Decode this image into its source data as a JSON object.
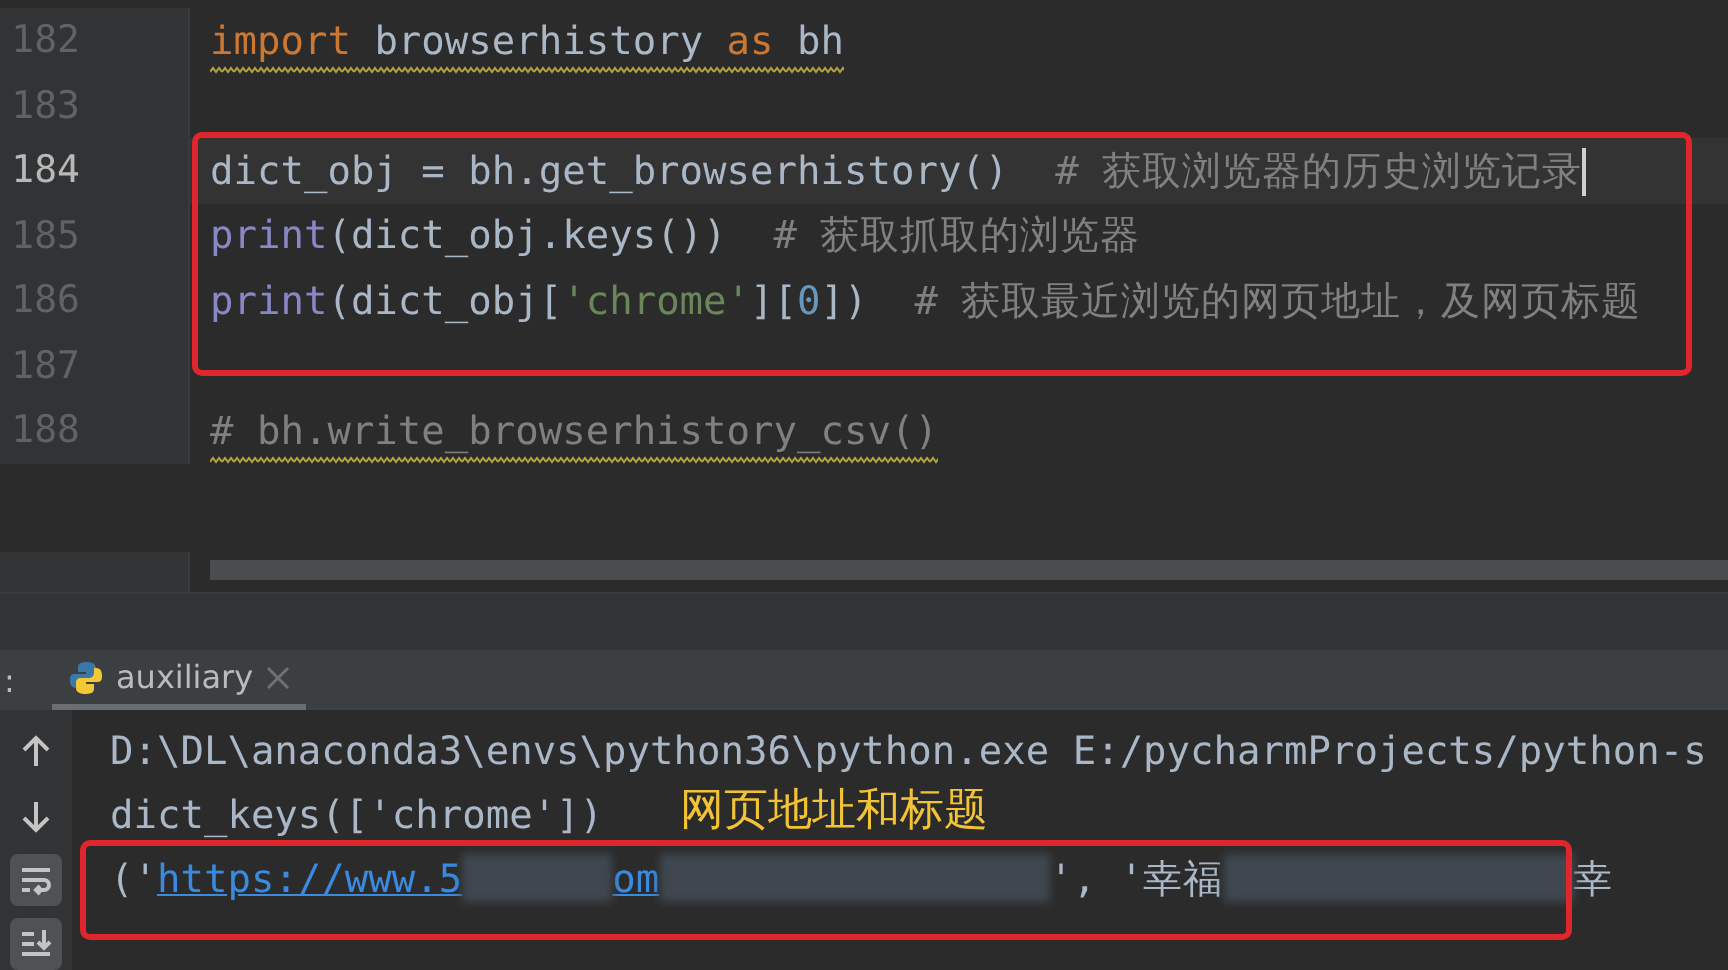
{
  "editor": {
    "lines": [
      {
        "number": "182",
        "current": false,
        "warning": true,
        "tokens": [
          {
            "kind": "keyword",
            "text": "import"
          },
          {
            "kind": "plain",
            "text": " browserhistory "
          },
          {
            "kind": "keyword",
            "text": "as"
          },
          {
            "kind": "plain",
            "text": " bh"
          }
        ]
      },
      {
        "number": "183",
        "current": false
      },
      {
        "number": "184",
        "current": true,
        "warning": false,
        "tokens": [
          {
            "kind": "plain",
            "text": "dict_obj = bh.get_browserhistory()  "
          },
          {
            "kind": "comment",
            "text": "# 获取浏览器的历史浏览记录"
          }
        ]
      },
      {
        "number": "185",
        "current": false,
        "warning": false,
        "tokens": [
          {
            "kind": "builtin",
            "text": "print"
          },
          {
            "kind": "plain",
            "text": "(dict_obj.keys())  "
          },
          {
            "kind": "comment",
            "text": "# 获取抓取的浏览器"
          }
        ]
      },
      {
        "number": "186",
        "current": false,
        "warning": false,
        "tokens": [
          {
            "kind": "builtin",
            "text": "print"
          },
          {
            "kind": "plain",
            "text": "(dict_obj["
          },
          {
            "kind": "string",
            "text": "'chrome'"
          },
          {
            "kind": "plain",
            "text": "]["
          },
          {
            "kind": "number",
            "text": "0"
          },
          {
            "kind": "plain",
            "text": "])  "
          },
          {
            "kind": "comment",
            "text": "# 获取最近浏览的网页地址，及网页标题"
          }
        ]
      },
      {
        "number": "187",
        "current": false
      },
      {
        "number": "188",
        "current": false,
        "warning": true,
        "tokens": [
          {
            "kind": "comment",
            "text": "# bh.write_browserhistory_csv()"
          }
        ]
      }
    ]
  },
  "run_panel": {
    "label": ":",
    "tabs": [
      {
        "label": "auxiliary",
        "selected": true
      }
    ],
    "toolbar": [
      {
        "kind": "up",
        "on": false
      },
      {
        "kind": "down",
        "on": false
      },
      {
        "kind": "wrap",
        "on": true
      },
      {
        "kind": "scroll-end",
        "on": true
      }
    ],
    "output": [
      [
        {
          "kind": "plain",
          "text": "D:\\DL\\anaconda3\\envs\\python36\\python.exe E:/pycharmProjects/python-s"
        }
      ],
      [
        {
          "kind": "plain",
          "text": "dict_keys(['chrome'])"
        }
      ],
      [
        {
          "kind": "plain",
          "text": "('"
        },
        {
          "kind": "link",
          "text": "https://www.5"
        },
        {
          "kind": "redacted"
        },
        {
          "kind": "link",
          "text": "om"
        },
        {
          "kind": "redacted"
        },
        {
          "kind": "plain",
          "text": "', '幸福"
        },
        {
          "kind": "redacted"
        },
        {
          "kind": "plain",
          "text": "幸"
        }
      ]
    ]
  },
  "annotations": [
    {
      "kind": "code-box"
    },
    {
      "kind": "label",
      "text": "网页地址和标题"
    },
    {
      "kind": "output-box"
    }
  ]
}
